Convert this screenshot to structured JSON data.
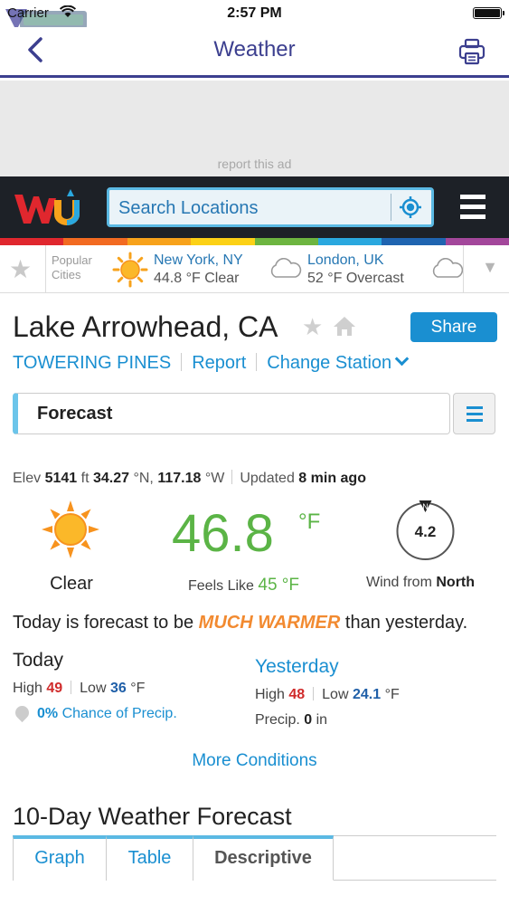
{
  "status_bar": {
    "carrier": "Carrier",
    "time": "2:57 PM"
  },
  "nav": {
    "title": "Weather"
  },
  "ad": {
    "report_label": "report this ad"
  },
  "wu": {
    "search_placeholder": "Search Locations"
  },
  "rainbow_colors": [
    "#e0272e",
    "#f26a21",
    "#f7a21b",
    "#fcd116",
    "#6db540",
    "#2aa8df",
    "#1f64b0",
    "#a3479b"
  ],
  "popular": {
    "label_line1": "Popular",
    "label_line2": "Cities",
    "cities": [
      {
        "name": "New York, NY",
        "condition": "44.8 °F Clear",
        "icon": "sun-icon"
      },
      {
        "name": "London, UK",
        "condition": "52 °F Overcast",
        "icon": "cloud-icon"
      }
    ]
  },
  "location": {
    "name": "Lake Arrowhead, CA",
    "share_label": "Share",
    "station": "TOWERING PINES",
    "report_label": "Report",
    "change_station_label": "Change Station"
  },
  "forecast_select": {
    "label": "Forecast"
  },
  "conditions": {
    "elev_label": "Elev",
    "elev_value": "5141",
    "elev_unit": "ft",
    "lat": "34.27",
    "lat_unit": "°N,",
    "lon": "117.18",
    "lon_unit": "°W",
    "updated_label": "Updated",
    "updated_value": "8 min ago",
    "condition": "Clear",
    "temperature": "46.8",
    "temp_unit": "°F",
    "feels_like_label": "Feels Like",
    "feels_like_value": "45 °F",
    "wind_speed": "4.2",
    "wind_label": "Wind from",
    "wind_direction": "North",
    "compass_letter": "N"
  },
  "summary": {
    "prefix": "Today is forecast to be",
    "emphasis": "MUCH WARMER",
    "suffix": "than yesterday."
  },
  "today": {
    "title": "Today",
    "high_label": "High",
    "high": "49",
    "low_label": "Low",
    "low": "36",
    "unit": "°F",
    "precip_value": "0%",
    "precip_label": "Chance of Precip."
  },
  "yesterday": {
    "title": "Yesterday",
    "high_label": "High",
    "high": "48",
    "low_label": "Low",
    "low": "24.1",
    "unit": "°F",
    "precip_label": "Precip.",
    "precip_value": "0",
    "precip_unit": "in"
  },
  "more_conditions_label": "More Conditions",
  "ten_day": {
    "title": "10-Day Weather Forecast",
    "tabs": [
      "Graph",
      "Table",
      "Descriptive"
    ],
    "active_tab": "Descriptive"
  },
  "colors": {
    "nav_accent": "#3c3f8f",
    "link_blue": "#1a8fd1",
    "temp_green": "#5bb446",
    "warmer_orange": "#f28a30",
    "high_red": "#d02b2b",
    "low_blue": "#1f5fa8"
  }
}
